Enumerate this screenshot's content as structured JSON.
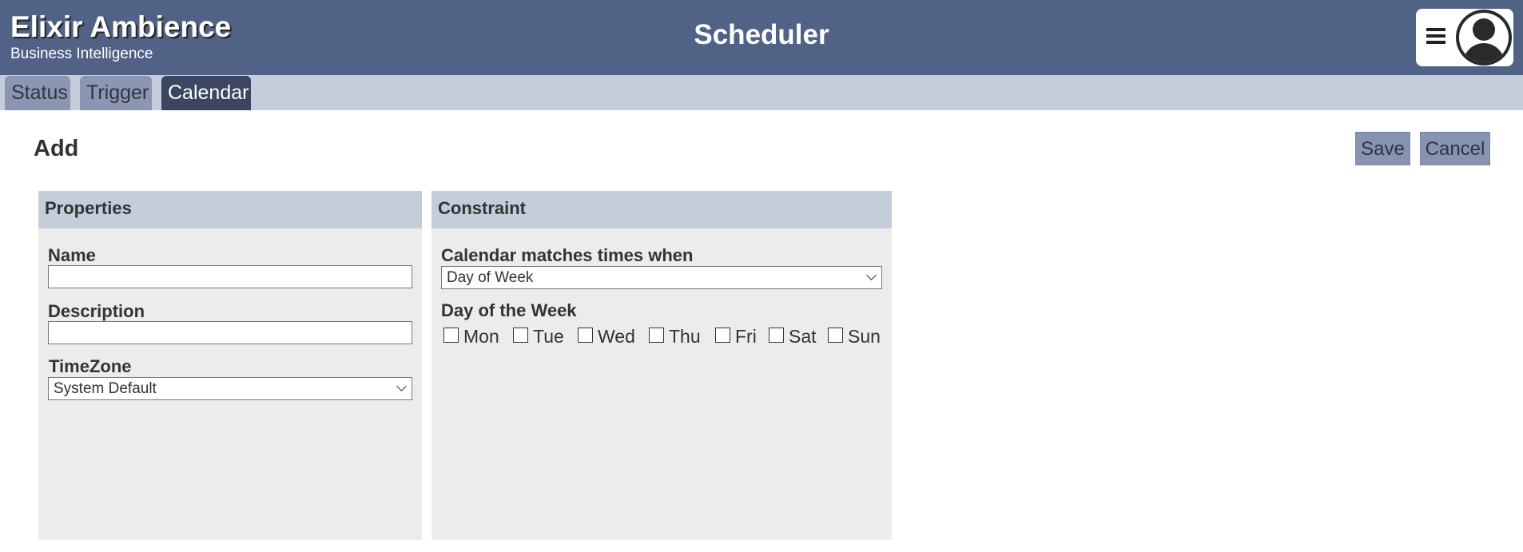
{
  "header": {
    "brand_title": "Elixir Ambience",
    "brand_subtitle": "Business Intelligence",
    "app_title": "Scheduler",
    "menu_icon": "hamburger-menu-icon",
    "avatar_icon": "user-avatar-icon",
    "background_color": "#516287"
  },
  "tabs": [
    {
      "label": "Status",
      "active": false
    },
    {
      "label": "Trigger",
      "active": false
    },
    {
      "label": "Calendar",
      "active": true
    }
  ],
  "page": {
    "title": "Add",
    "save_label": "Save",
    "cancel_label": "Cancel"
  },
  "properties_panel": {
    "title": "Properties",
    "name_label": "Name",
    "name_value": "",
    "description_label": "Description",
    "description_value": "",
    "timezone_label": "TimeZone",
    "timezone_value": "System Default"
  },
  "constraint_panel": {
    "title": "Constraint",
    "match_label": "Calendar matches times when",
    "match_value": "Day of Week",
    "days_label": "Day of the Week",
    "days": [
      {
        "label": "Mon",
        "checked": false
      },
      {
        "label": "Tue",
        "checked": false
      },
      {
        "label": "Wed",
        "checked": false
      },
      {
        "label": "Thu",
        "checked": false
      },
      {
        "label": "Fri",
        "checked": false
      },
      {
        "label": "Sat",
        "checked": false
      },
      {
        "label": "Sun",
        "checked": false
      }
    ]
  },
  "colors": {
    "tabbar": "#c5ccda",
    "tab_inactive": "#8b97b2",
    "tab_active": "#3b4662",
    "button": "#8794b0",
    "panel": "#ececec"
  }
}
